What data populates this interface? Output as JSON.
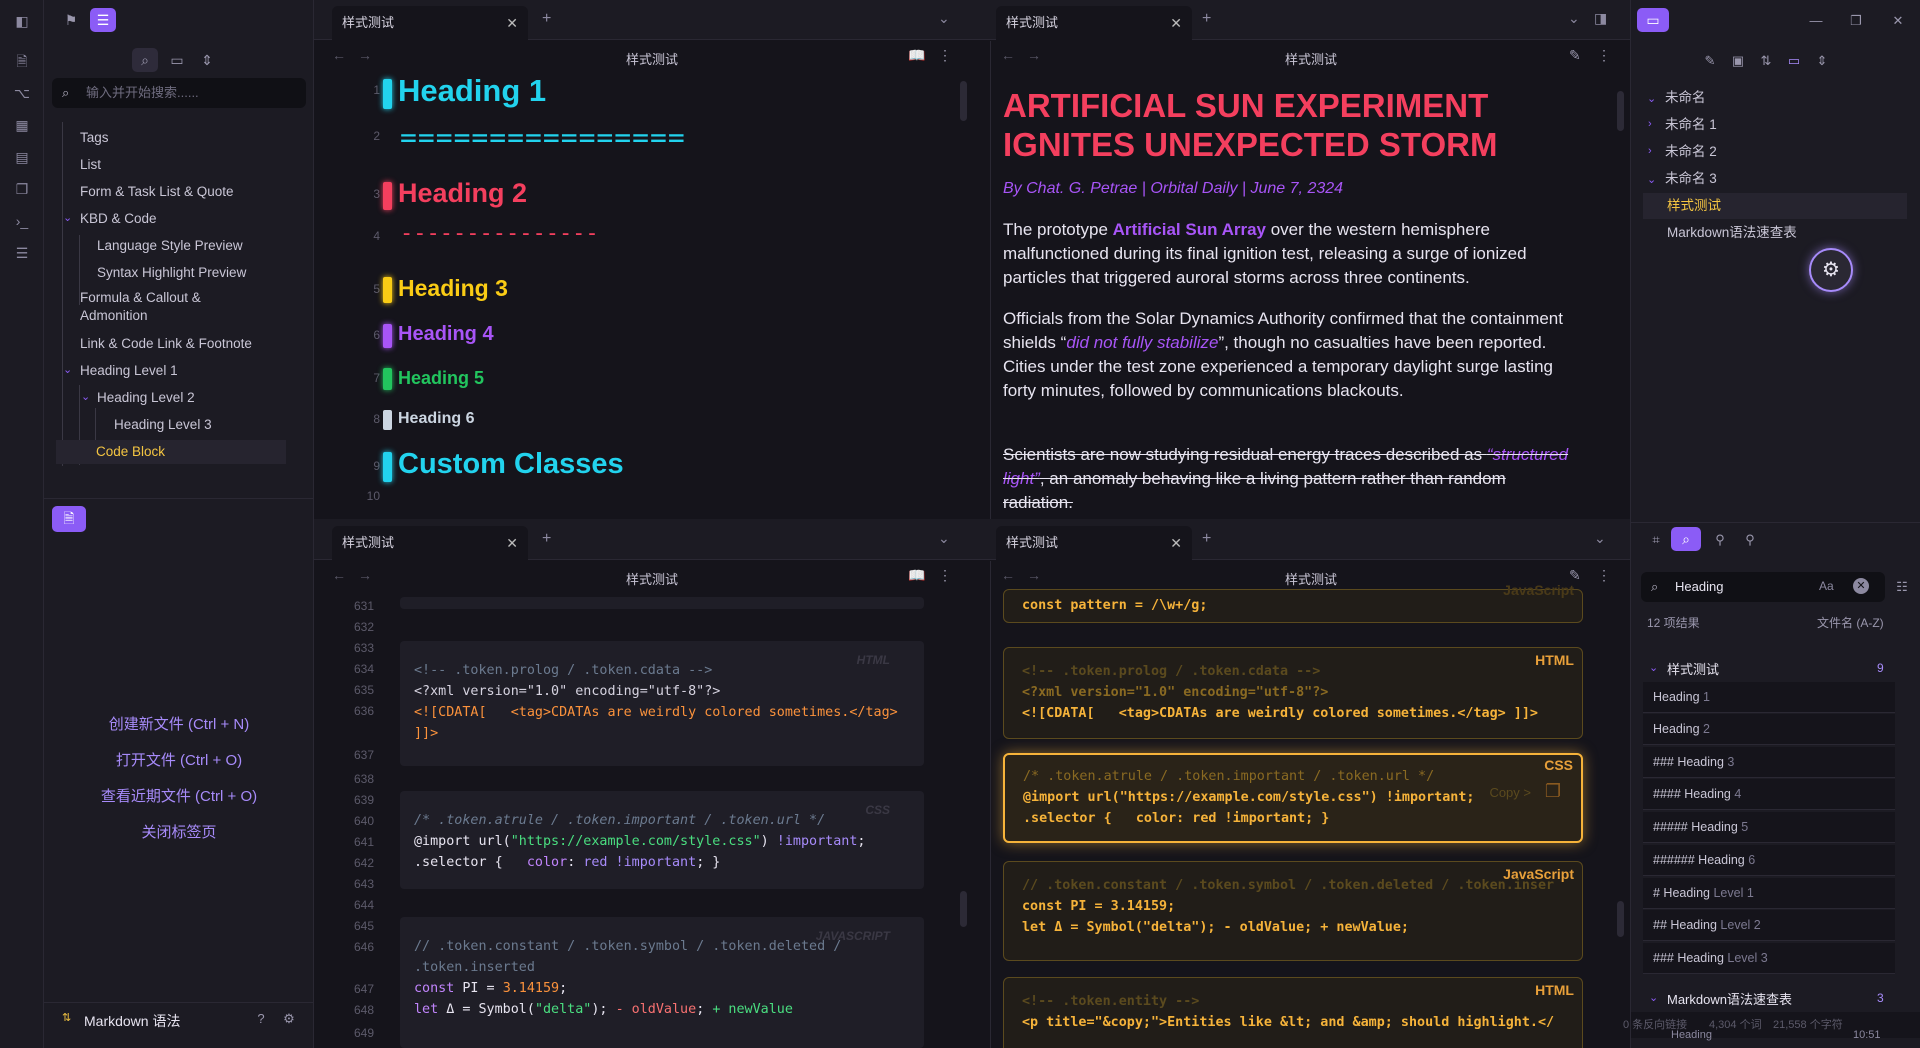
{
  "ribbon": {
    "icons": [
      "sidebar-toggle-icon",
      "bookmark-icon",
      "list-icon",
      "file-icon",
      "graph-icon",
      "grid-icon",
      "calendar-icon",
      "copy-icon",
      "terminal-icon",
      "tasks-icon"
    ]
  },
  "left": {
    "search_placeholder": "输入并开始搜索......",
    "items": [
      "Tags",
      "List",
      "Form & Task List & Quote",
      "KBD & Code",
      "Language Style Preview",
      "Syntax Highlight Preview",
      "Formula & Callout &",
      "Admonition",
      "Link & Code Link & Footnote",
      "Heading Level 1",
      "Heading Level 2",
      "Heading Level 3",
      "Code Block"
    ],
    "quick": [
      "创建新文件 (Ctrl + N)",
      "打开文件 (Ctrl + O)",
      "查看近期文件 (Ctrl + O)",
      "关闭标签页"
    ],
    "vault": "Markdown 语法"
  },
  "tabs": {
    "name": "样式测试",
    "view_title": "样式测试"
  },
  "editor_top": {
    "lines": [
      "1",
      "2",
      "3",
      "4",
      "5",
      "6",
      "7",
      "8",
      "9",
      "10"
    ],
    "h1": "Heading 1",
    "eq": "================",
    "h2": "Heading 2",
    "dash": "---------------",
    "h3": "Heading 3",
    "h4": "Heading 4",
    "h5": "Heading 5",
    "h6": "Heading 6",
    "custom": "Custom Classes"
  },
  "reading": {
    "title": "ARTIFICIAL SUN EXPERIMENT IGNITES UNEXPECTED STORM",
    "byline": "By Chat. G. Petrae | Orbital Daily | June 7, 2324",
    "p1a": "The prototype ",
    "p1b": "Artificial Sun Array",
    "p1c": " over the western hemisphere malfunctioned during its final ignition test, releasing a surge of ionized particles that triggered auroral storms across three continents.",
    "p2a": "Officials from the Solar Dynamics Authority confirmed that the containment shields “",
    "p2b": "did not fully stabilize",
    "p2c": "”, though no casualties have been reported. Cities under the test zone experienced a temporary daylight surge lasting forty minutes, followed by communications blackouts.",
    "p3a": "Scientists are now studying residual energy traces described as ",
    "p3b": "“structured light”",
    "p3c": ", an anomaly behaving like a living pattern rather than random radiation."
  },
  "editor_bottom": {
    "lines": [
      "631",
      "632",
      "633",
      "634",
      "635",
      "636",
      "",
      "637",
      "638",
      "639",
      "640",
      "641",
      "642",
      "643",
      "644",
      "645",
      "646",
      "",
      "647",
      "648",
      "649"
    ],
    "c1": "<!-- .token.prolog / .token.cdata -->",
    "c2": "<?xml version=\"1.0\" encoding=\"utf-8\"?>",
    "c3": "<![CDATA[   <tag>CDATAs are weirdly colored sometimes.</tag>",
    "c4": "]]>",
    "c5": "/* .token.atrule / .token.important / .token.url */",
    "c6a": "@import url(",
    "c6b": "\"https://example.com/style.css\"",
    "c6c": ") ",
    "c6d": "!important",
    ";": ";",
    "c7a": ".selector {   ",
    "c7b": "color",
    "c7c": ": ",
    "c7d": "red !important",
    "c7e": "; }",
    "c8": "// .token.constant / .token.symbol / .token.deleted /",
    "c9": ".token.inserted",
    "c10a": "const ",
    "c10b": "PI",
    "c10c": " = ",
    "c10d": "3.14159",
    "c11a": "let ",
    "c11b": "Δ",
    "c11c": " = Symbol(",
    "c11d": "\"delta\"",
    "c11e": "); ",
    "c11f": "- oldValue",
    "c11g": "; ",
    "c11h": "+ newValue",
    "tag_html": "HTML",
    "tag_css": "CSS",
    "tag_js": "JAVASCRIPT"
  },
  "reading_bottom": {
    "r0": "const pattern = /\\w+/g;",
    "r1": "<!-- .token.prolog / .token.cdata -->",
    "r2": "<?xml version=\"1.0\" encoding=\"utf-8\"?>",
    "r3": "<![CDATA[   <tag>CDATAs are weirdly colored sometimes.</tag> ]]>",
    "r4": "/* .token.atrule / .token.important / .token.url */",
    "r5": "@import url(\"https://example.com/style.css\") !important;",
    "r6": ".selector {   color: red !important; }",
    "r7": "// .token.constant / .token.symbol / .token.deleted / .token.inser",
    "r8": "const PI = 3.14159;",
    "r9": "let Δ = Symbol(\"delta\"); - oldValue; + newValue;",
    "r10": "<!-- .token.entity -->",
    "r11": "<p title=\"&copy;\">Entities like &lt; and &amp; should highlight.</",
    "tag_html": "HTML",
    "tag_css": "CSS",
    "tag_js": "JavaScript",
    "tag_js_top": "JavaScript",
    "copy": "Copy >"
  },
  "right": {
    "files": [
      "未命名",
      "未命名 1",
      "未命名 2",
      "未命名 3",
      "样式测试",
      "Markdown语法速查表"
    ],
    "search_value": "Heading",
    "case": "Aa",
    "count": "12 项结果",
    "sort": "文件名 (A-Z)",
    "group1": "样式测试",
    "group1_count": "9",
    "results": [
      {
        "a": "Heading",
        "b": " 1"
      },
      {
        "a": "Heading",
        "b": " 2"
      },
      {
        "a": "### Heading",
        "b": " 3"
      },
      {
        "a": "#### Heading",
        "b": " 4"
      },
      {
        "a": "##### Heading",
        "b": " 5"
      },
      {
        "a": "###### Heading",
        "b": " 6"
      },
      {
        "a": "# Heading",
        "b": " Level 1"
      },
      {
        "a": "## Heading",
        "b": " Level 2"
      },
      {
        "a": "### Heading",
        "b": " Level 3"
      }
    ],
    "group2": "Markdown语法速查表",
    "group2_count": "3",
    "status": "0 条反向链接",
    "words": "4,304 个词",
    "chars": "21,558 个字符",
    "tail": "Heading",
    "clock": "10:51"
  }
}
